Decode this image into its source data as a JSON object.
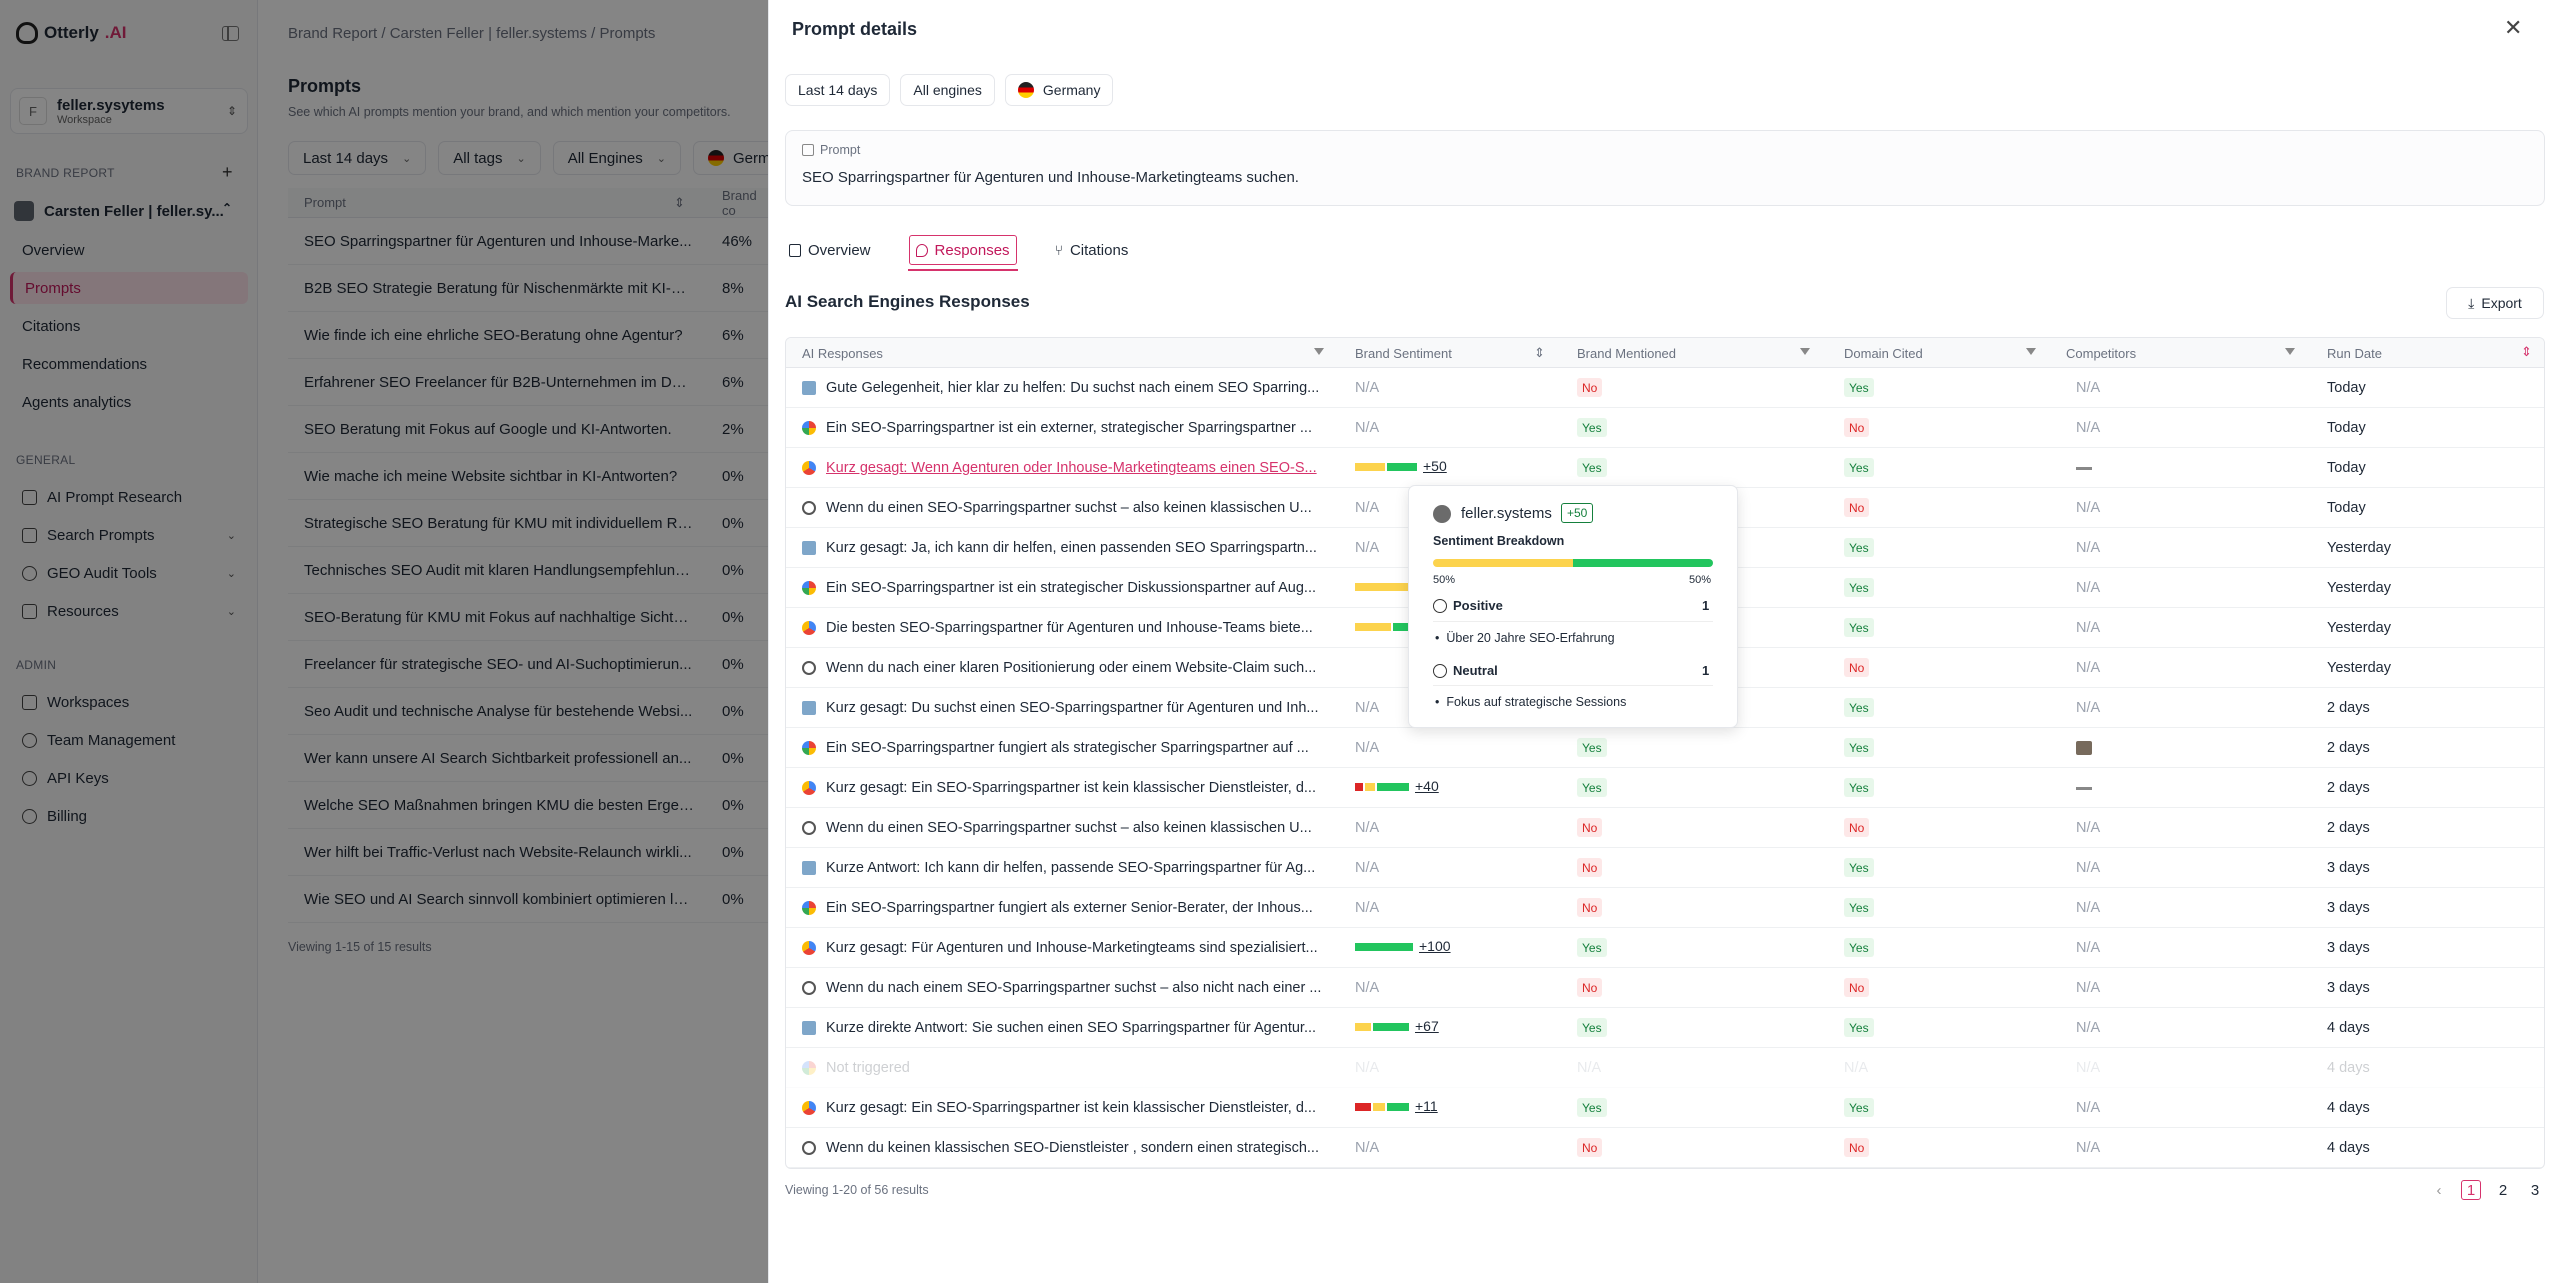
{
  "sidebar": {
    "logo_main": "Otterly",
    "logo_ai": ".AI",
    "workspace": {
      "initial": "F",
      "name": "feller.sysytems",
      "sub": "Workspace"
    },
    "brand_report_label": "BRAND REPORT",
    "brand_name": "Carsten Feller | feller.sy...",
    "brand_items": [
      "Overview",
      "Prompts",
      "Citations",
      "Recommendations",
      "Agents analytics"
    ],
    "general_label": "GENERAL",
    "general_items": [
      "AI Prompt Research",
      "Search Prompts",
      "GEO Audit Tools",
      "Resources"
    ],
    "admin_label": "ADMIN",
    "admin_items": [
      "Workspaces",
      "Team Management",
      "API Keys",
      "Billing"
    ]
  },
  "main": {
    "breadcrumb": "Brand Report  /  Carsten Feller | feller.systems  /  Prompts",
    "title": "Prompts",
    "subtitle": "See which AI prompts mention your brand, and which mention your competitors.",
    "filters": [
      "Last 14 days",
      "All tags",
      "All Engines",
      "Germa"
    ],
    "col_prompt": "Prompt",
    "col_brand": "Brand co",
    "rows": [
      {
        "t": "SEO Sparringspartner für Agenturen und Inhouse-Marke...",
        "p": "46%"
      },
      {
        "t": "B2B SEO Strategie Beratung für Nischenmärkte mit KI-Fo...",
        "p": "8%"
      },
      {
        "t": "Wie finde ich eine ehrliche SEO-Beratung ohne Agentur?",
        "p": "6%"
      },
      {
        "t": "Erfahrener SEO Freelancer für B2B-Unternehmen im DA...",
        "p": "6%"
      },
      {
        "t": "SEO Beratung mit Fokus auf Google und KI-Antworten.",
        "p": "2%"
      },
      {
        "t": "Wie mache ich meine Website sichtbar in KI-Antworten?",
        "p": "0%"
      },
      {
        "t": "Strategische SEO Beratung für KMU mit individuellem Re...",
        "p": "0%"
      },
      {
        "t": "Technisches SEO Audit mit klaren Handlungsempfehlung...",
        "p": "0%"
      },
      {
        "t": "SEO-Beratung für KMU mit Fokus auf nachhaltige Sichtb...",
        "p": "0%"
      },
      {
        "t": "Freelancer für strategische SEO- und AI-Suchoptimierun...",
        "p": "0%"
      },
      {
        "t": "Seo Audit und technische Analyse für bestehende Websi...",
        "p": "0%"
      },
      {
        "t": "Wer kann unsere AI Search Sichtbarkeit professionell an...",
        "p": "0%"
      },
      {
        "t": "Welche SEO Maßnahmen bringen KMU die besten Ergeb...",
        "p": "0%"
      },
      {
        "t": "Wer hilft bei Traffic-Verlust nach Website-Relaunch wirkli...",
        "p": "0%"
      },
      {
        "t": "Wie SEO und AI Search sinnvoll kombiniert optimieren la...",
        "p": "0%"
      }
    ],
    "viewing": "Viewing 1-15 of 15 results"
  },
  "panel": {
    "title": "Prompt details",
    "chips": [
      "Last 14 days",
      "All engines",
      "Germany"
    ],
    "prompt_label": "Prompt",
    "prompt_text": "SEO Sparringspartner für Agenturen und Inhouse-Marketingteams suchen.",
    "tabs": [
      "Overview",
      "Responses",
      "Citations"
    ],
    "section_title": "AI Search Engines Responses",
    "export": "Export",
    "cols": [
      "AI Responses",
      "Brand Sentiment",
      "Brand Mentioned",
      "Domain Cited",
      "Competitors",
      "Run Date"
    ],
    "rows": [
      {
        "e": "p",
        "t": "Gute Gelegenheit, hier klar zu helfen: Du suchst nach einem SEO Sparring...",
        "s": "N/A",
        "m": "No",
        "d": "Yes",
        "c": "N/A",
        "r": "Today"
      },
      {
        "e": "g",
        "t": "Ein SEO-Sparringspartner ist ein externer, strategischer Sparringspartner ...",
        "s": "N/A",
        "m": "Yes",
        "d": "No",
        "c": "N/A",
        "r": "Today"
      },
      {
        "e": "a",
        "t": "Kurz gesagt: Wenn Agenturen oder Inhouse-Marketingteams einen SEO-S...",
        "s": "+50",
        "m": "Yes",
        "d": "Yes",
        "c": "dash",
        "r": "Today",
        "link": true,
        "bar": [
          [
            0,
            0,
            0
          ],
          [
            30,
            "#fcd34d"
          ],
          [
            30,
            "#22c55e"
          ]
        ]
      },
      {
        "e": "c",
        "t": "Wenn du einen SEO-Sparringspartner suchst – also keinen klassischen U...",
        "s": "N/A",
        "m": "No",
        "d": "No",
        "c": "N/A",
        "r": "Today"
      },
      {
        "e": "p",
        "t": "Kurz gesagt: Ja, ich kann dir helfen, einen passenden SEO Sparringspartn...",
        "s": "N/A",
        "m": "No",
        "d": "Yes",
        "c": "N/A",
        "r": "Yesterday"
      },
      {
        "e": "g",
        "t": "Ein SEO-Sparringspartner ist ein strategischer Diskussionspartner auf Aug...",
        "s": "",
        "m": "Yes",
        "d": "Yes",
        "c": "N/A",
        "r": "Yesterday",
        "bar": [
          [
            0,
            0,
            0
          ],
          [
            54,
            "#fcd34d"
          ]
        ]
      },
      {
        "e": "a",
        "t": "Die besten SEO-Sparringspartner für Agenturen und Inhouse-Teams biete...",
        "s": "",
        "m": "Yes",
        "d": "Yes",
        "c": "N/A",
        "r": "Yesterday",
        "bar": [
          [
            0,
            0,
            0
          ],
          [
            36,
            "#fcd34d"
          ],
          [
            18,
            "#22c55e"
          ]
        ]
      },
      {
        "e": "c",
        "t": "Wenn du nach einer klaren Positionierung oder einem Website-Claim such...",
        "s": "",
        "m": "No",
        "d": "No",
        "c": "N/A",
        "r": "Yesterday"
      },
      {
        "e": "p",
        "t": "Kurz gesagt: Du suchst einen SEO-Sparringspartner für Agenturen und Inh...",
        "s": "N/A",
        "m": "No",
        "d": "Yes",
        "c": "N/A",
        "r": "2 days"
      },
      {
        "e": "g",
        "t": "Ein SEO-Sparringspartner fungiert als strategischer Sparringspartner auf ...",
        "s": "N/A",
        "m": "Yes",
        "d": "Yes",
        "c": "img",
        "r": "2 days"
      },
      {
        "e": "a",
        "t": "Kurz gesagt: Ein SEO-Sparringspartner ist kein klassischer Dienstleister, d...",
        "s": "+40",
        "m": "Yes",
        "d": "Yes",
        "c": "dash",
        "r": "2 days",
        "bar": [
          [
            8,
            "#dc2626"
          ],
          [
            10,
            "#fcd34d"
          ],
          [
            32,
            "#22c55e"
          ]
        ]
      },
      {
        "e": "c",
        "t": "Wenn du einen SEO-Sparringspartner suchst – also keinen klassischen U...",
        "s": "N/A",
        "m": "No",
        "d": "No",
        "c": "N/A",
        "r": "2 days"
      },
      {
        "e": "p",
        "t": "Kurze Antwort: Ich kann dir helfen, passende SEO-Sparringspartner für Ag...",
        "s": "N/A",
        "m": "No",
        "d": "Yes",
        "c": "N/A",
        "r": "3 days"
      },
      {
        "e": "g",
        "t": "Ein SEO-Sparringspartner fungiert als externer Senior-Berater, der Inhous...",
        "s": "N/A",
        "m": "No",
        "d": "Yes",
        "c": "N/A",
        "r": "3 days"
      },
      {
        "e": "a",
        "t": "Kurz gesagt: Für Agenturen und Inhouse-Marketingteams sind spezialisiert...",
        "s": "+100",
        "m": "Yes",
        "d": "Yes",
        "c": "N/A",
        "r": "3 days",
        "bar": [
          [
            0,
            0,
            0
          ],
          [
            0,
            0
          ],
          [
            58,
            "#22c55e"
          ]
        ]
      },
      {
        "e": "c",
        "t": "Wenn du nach einem SEO-Sparringspartner suchst – also nicht nach einer ...",
        "s": "N/A",
        "m": "No",
        "d": "No",
        "c": "N/A",
        "r": "3 days"
      },
      {
        "e": "p",
        "t": "Kurze direkte Antwort: Sie suchen einen SEO Sparringspartner für Agentur...",
        "s": "+67",
        "m": "Yes",
        "d": "Yes",
        "c": "N/A",
        "r": "4 days",
        "bar": [
          [
            0,
            0,
            0
          ],
          [
            16,
            "#fcd34d"
          ],
          [
            36,
            "#22c55e"
          ]
        ]
      },
      {
        "e": "g",
        "t": "Not triggered",
        "s": "N/A",
        "m": "N/A",
        "d": "N/A",
        "c": "N/A",
        "r": "4 days",
        "faded": true
      },
      {
        "e": "a",
        "t": "Kurz gesagt: Ein SEO-Sparringspartner ist kein klassischer Dienstleister, d...",
        "s": "+11",
        "m": "Yes",
        "d": "Yes",
        "c": "N/A",
        "r": "4 days",
        "bar": [
          [
            16,
            "#dc2626"
          ],
          [
            12,
            "#fcd34d"
          ],
          [
            22,
            "#22c55e"
          ]
        ]
      },
      {
        "e": "c",
        "t": "Wenn du keinen klassischen SEO-Dienstleister , sondern einen strategisch...",
        "s": "N/A",
        "m": "No",
        "d": "No",
        "c": "N/A",
        "r": "4 days"
      }
    ],
    "viewing": "Viewing 1-20 of 56 results",
    "pages": [
      "1",
      "2",
      "3"
    ],
    "tooltip": {
      "brand": "feller.systems",
      "score": "+50",
      "heading": "Sentiment Breakdown",
      "left_pct": "50%",
      "right_pct": "50%",
      "positive_label": "Positive",
      "positive_count": "1",
      "positive_item": "Über 20 Jahre SEO-Erfahrung",
      "neutral_label": "Neutral",
      "neutral_count": "1",
      "neutral_item": "Fokus auf strategische Sessions"
    }
  }
}
